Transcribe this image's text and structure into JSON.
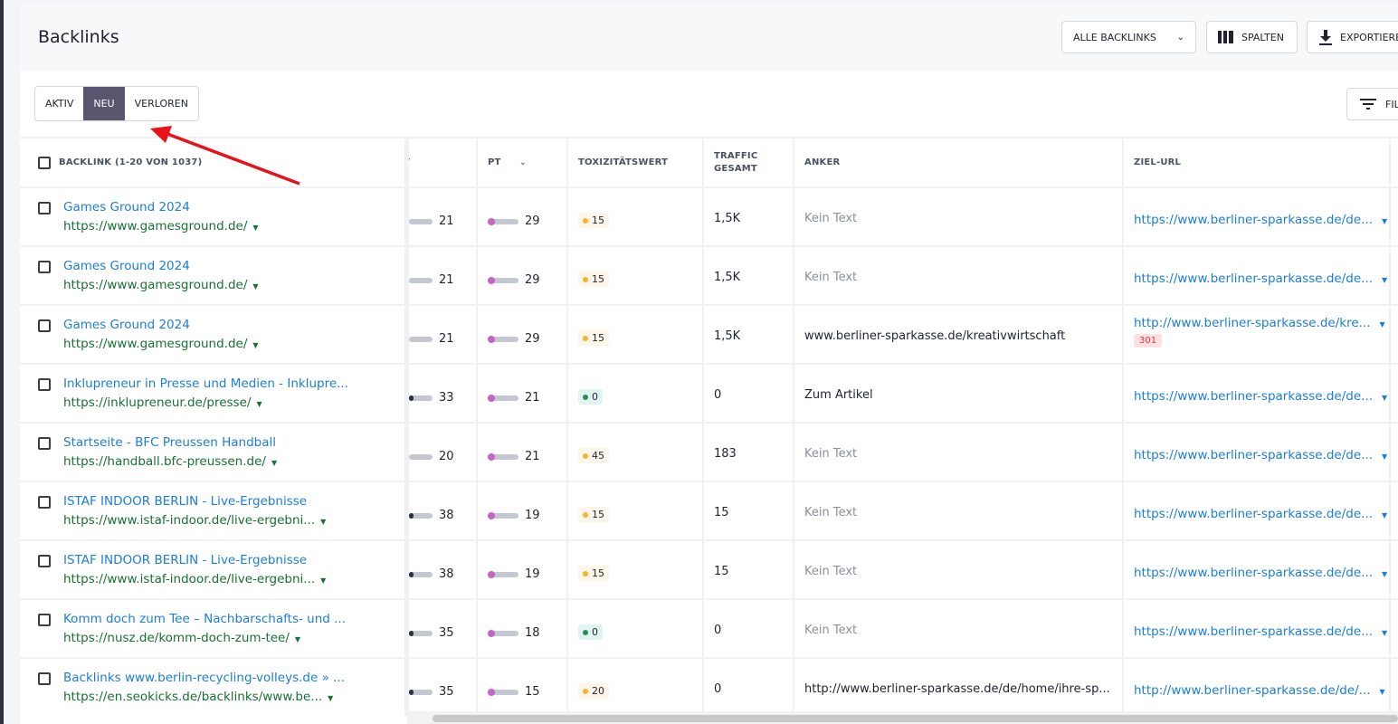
{
  "header": {
    "title": "Backlinks",
    "all_backlinks": "ALLE BACKLINKS",
    "columns": "SPALTEN",
    "export": "EXPORTIEREN"
  },
  "tabs": [
    {
      "label": "AKTIV"
    },
    {
      "label": "NEU",
      "active": true
    },
    {
      "label": "VERLOREN"
    }
  ],
  "filter_label": "FILTER",
  "table": {
    "headers": {
      "backlink": "BACKLINK (1-20 VON 1037)",
      "t": "T",
      "pt": "PT",
      "tox": "TOXIZITÄTSWERT",
      "traffic": "TRAFFIC GESAMT",
      "anker": "ANKER",
      "ziel": "ZIEL-URL"
    },
    "rows": [
      {
        "title": "Games Ground 2024",
        "url": "https://www.gamesground.de/",
        "t": "21",
        "pt": "29",
        "tox": "15",
        "tox_level": "medium",
        "traffic": "1,5K",
        "anker": "Kein Text",
        "anker_muted": true,
        "ziel": "https://www.berliner-sparkasse.de/de..."
      },
      {
        "title": "Games Ground 2024",
        "url": "https://www.gamesground.de/",
        "t": "21",
        "pt": "29",
        "tox": "15",
        "tox_level": "medium",
        "traffic": "1,5K",
        "anker": "Kein Text",
        "anker_muted": true,
        "ziel": "https://www.berliner-sparkasse.de/de..."
      },
      {
        "title": "Games Ground 2024",
        "url": "https://www.gamesground.de/",
        "t": "21",
        "pt": "29",
        "tox": "15",
        "tox_level": "medium",
        "traffic": "1,5K",
        "anker": "www.berliner-sparkasse.de/kreativwirtschaft",
        "anker_muted": false,
        "ziel": "http://www.berliner-sparkasse.de/kre...",
        "code": "301"
      },
      {
        "title": "Inklupreneur in Presse und Medien - Inklupre...",
        "url": "https://inklupreneur.de/presse/",
        "t": "33",
        "pt": "21",
        "tox": "0",
        "tox_level": "low",
        "traffic": "0",
        "anker": "Zum Artikel",
        "anker_muted": false,
        "ziel": "https://www.berliner-sparkasse.de/de..."
      },
      {
        "title": "Startseite - BFC Preussen Handball",
        "url": "https://handball.bfc-preussen.de/",
        "t": "20",
        "pt": "21",
        "tox": "45",
        "tox_level": "medium",
        "traffic": "183",
        "anker": "Kein Text",
        "anker_muted": true,
        "ziel": "https://www.berliner-sparkasse.de/de..."
      },
      {
        "title": "ISTAF INDOOR BERLIN - Live-Ergebnisse",
        "url": "https://www.istaf-indoor.de/live-ergebni...",
        "t": "38",
        "pt": "19",
        "tox": "15",
        "tox_level": "medium",
        "traffic": "15",
        "anker": "Kein Text",
        "anker_muted": true,
        "ziel": "https://www.berliner-sparkasse.de/de..."
      },
      {
        "title": "ISTAF INDOOR BERLIN - Live-Ergebnisse",
        "url": "https://www.istaf-indoor.de/live-ergebni...",
        "t": "38",
        "pt": "19",
        "tox": "15",
        "tox_level": "medium",
        "traffic": "15",
        "anker": "Kein Text",
        "anker_muted": true,
        "ziel": "https://www.berliner-sparkasse.de/de..."
      },
      {
        "title": "Komm doch zum Tee – Nachbarschafts- und ...",
        "url": "https://nusz.de/komm-doch-zum-tee/",
        "t": "35",
        "pt": "18",
        "tox": "0",
        "tox_level": "low",
        "traffic": "0",
        "anker": "Kein Text",
        "anker_muted": true,
        "ziel": "https://www.berliner-sparkasse.de/de..."
      },
      {
        "title": "Backlinks www.berlin-recycling-volleys.de » ...",
        "url": "https://en.seokicks.de/backlinks/www.be...",
        "t": "35",
        "pt": "15",
        "tox": "20",
        "tox_level": "medium",
        "traffic": "0",
        "anker": "http://www.berliner-sparkasse.de/de/home/ihre-sp...",
        "anker_muted": false,
        "ziel": "http://www.berliner-sparkasse.de/de/..."
      }
    ]
  },
  "colors": {
    "link": "#1c7ed6",
    "url": "#187034",
    "active_tab": "#5a5670",
    "tox_low": "#2e8b57",
    "tox_medium": "#f5b431",
    "pt_dot": "#c963c9",
    "annotation_arrow": "#e8121b"
  }
}
